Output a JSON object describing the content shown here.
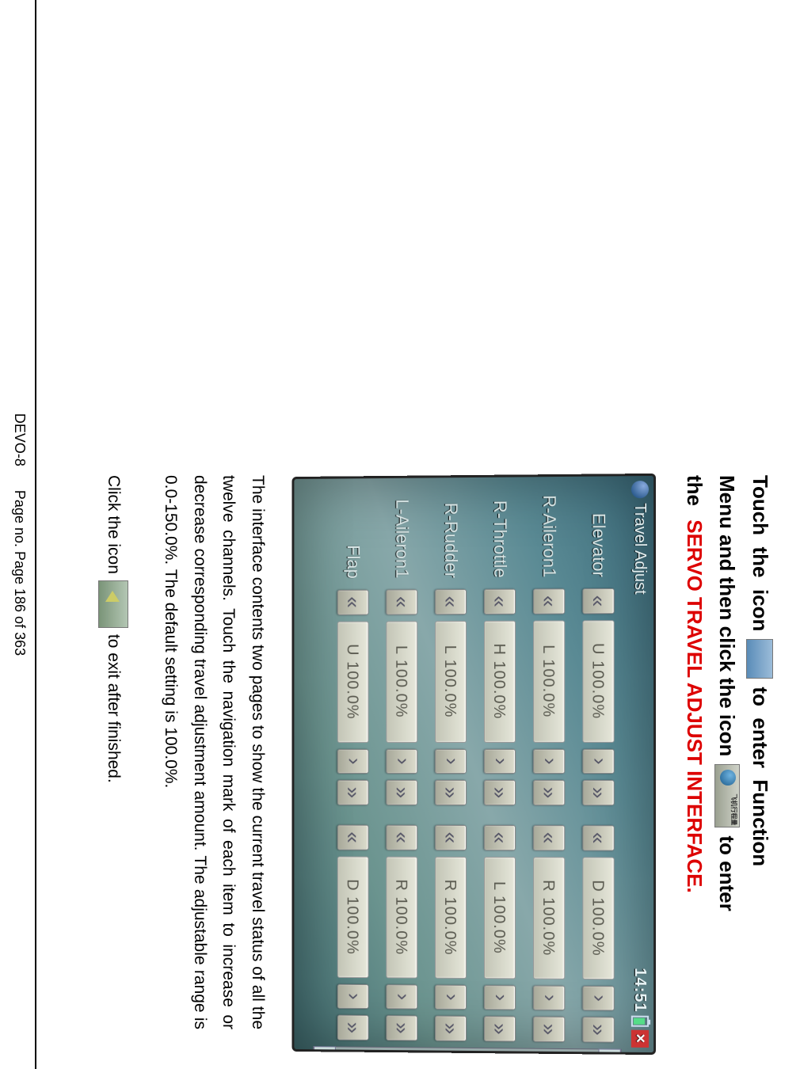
{
  "heading": {
    "part1": "Touch  the  icon",
    "part2": "to  enter  Function",
    "part3": "Menu and then click the icon",
    "model_icon_text": "飞机行程量",
    "part4": "to enter",
    "part5": "the ",
    "red": "SERVO TRAVEL ADJUST INTERFACE."
  },
  "screenshot": {
    "title": "Travel Adjust",
    "clock": "14:51",
    "rows": [
      {
        "label": "Elevator",
        "left": "U 100.0%",
        "right": "D 100.0%"
      },
      {
        "label": "R-Aileron1",
        "left": "L 100.0%",
        "right": "R 100.0%"
      },
      {
        "label": "R-Throttle",
        "left": "H 100.0%",
        "right": "L 100.0%"
      },
      {
        "label": "R-Rudder",
        "left": "L 100.0%",
        "right": "R 100.0%"
      },
      {
        "label": "L-Aileron1",
        "left": "L 100.0%",
        "right": "R 100.0%"
      },
      {
        "label": "Flap",
        "left": "U 100.0%",
        "right": "D 100.0%"
      }
    ]
  },
  "paragraph": "The interface contents two pages to show the current travel status of all the twelve channels. Touch the navigation mark of each item to increase or decrease corresponding travel adjustment amount. The adjustable range is 0.0-150.0%. The default setting is 100.0%.",
  "exit": {
    "pre": "Click the icon",
    "post": "to exit after finished."
  },
  "footer": {
    "left": "DEVO-8",
    "right": "Page no. Page 186 of 363"
  }
}
